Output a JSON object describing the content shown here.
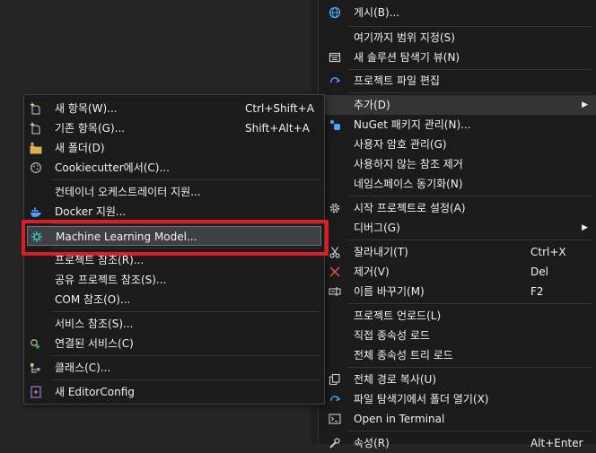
{
  "main_menu": {
    "items": [
      {
        "label": "게시(B)...",
        "icon": "globe-icon"
      },
      {
        "label": "여기까지 범위 지정(S)",
        "icon": ""
      },
      {
        "label": "새 솔루션 탐색기 뷰(N)",
        "icon": "solution-view-icon"
      },
      {
        "label": "프로젝트 파일 편집",
        "icon": "edit-redo-icon"
      },
      {
        "label": "추가(D)",
        "icon": "",
        "submenu": true
      },
      {
        "label": "NuGet 패키지 관리(N)...",
        "icon": "nuget-icon"
      },
      {
        "label": "사용자 암호 관리(G)",
        "icon": ""
      },
      {
        "label": "사용하지 않는 참조 제거",
        "icon": ""
      },
      {
        "label": "네임스페이스 동기화(N)",
        "icon": ""
      },
      {
        "label": "시작 프로젝트로 설정(A)",
        "icon": "gear-icon"
      },
      {
        "label": "디버그(G)",
        "icon": "",
        "submenu": true
      },
      {
        "label": "잘라내기(T)",
        "icon": "scissors-icon",
        "shortcut": "Ctrl+X"
      },
      {
        "label": "제거(V)",
        "icon": "delete-x-icon",
        "shortcut": "Del"
      },
      {
        "label": "이름 바꾸기(M)",
        "icon": "rename-icon",
        "shortcut": "F2"
      },
      {
        "label": "프로젝트 언로드(L)",
        "icon": ""
      },
      {
        "label": "직접 종속성 로드",
        "icon": ""
      },
      {
        "label": "전체 종속성 트리 로드",
        "icon": ""
      },
      {
        "label": "전체 경로 복사(U)",
        "icon": "copy-icon"
      },
      {
        "label": "파일 탐색기에서 폴더 열기(X)",
        "icon": "refresh-icon"
      },
      {
        "label": "Open in Terminal",
        "icon": "terminal-icon"
      },
      {
        "label": "속성(R)",
        "icon": "wrench-icon",
        "shortcut": "Alt+Enter"
      }
    ]
  },
  "sub_menu": {
    "items": [
      {
        "label": "새 항목(W)...",
        "shortcut": "Ctrl+Shift+A",
        "icon": "new-item-icon"
      },
      {
        "label": "기존 항목(G)...",
        "shortcut": "Shift+Alt+A",
        "icon": "existing-item-icon"
      },
      {
        "label": "새 폴더(D)",
        "icon": "new-folder-icon"
      },
      {
        "label": "Cookiecutter에서(C)...",
        "icon": "cookiecutter-icon"
      },
      {
        "label": "컨테이너 오케스트레이터 지원...",
        "icon": ""
      },
      {
        "label": "Docker 지원...",
        "icon": "docker-icon"
      },
      {
        "label": "Machine Learning Model...",
        "icon": "ml-model-icon"
      },
      {
        "label": "프로젝트 참조(R)...",
        "icon": ""
      },
      {
        "label": "공유 프로젝트 참조(S)...",
        "icon": ""
      },
      {
        "label": "COM 참조(O)...",
        "icon": ""
      },
      {
        "label": "서비스 참조(S)...",
        "icon": ""
      },
      {
        "label": "연결된 서비스(C)",
        "icon": "connected-service-icon"
      },
      {
        "label": "클래스(C)...",
        "icon": "class-icon"
      },
      {
        "label": "새 EditorConfig",
        "icon": "editorconfig-icon"
      }
    ]
  },
  "colors": {
    "highlight_box": "#e01b24",
    "menu_bg": "#1b1b1c",
    "text": "#f1f1f1"
  }
}
